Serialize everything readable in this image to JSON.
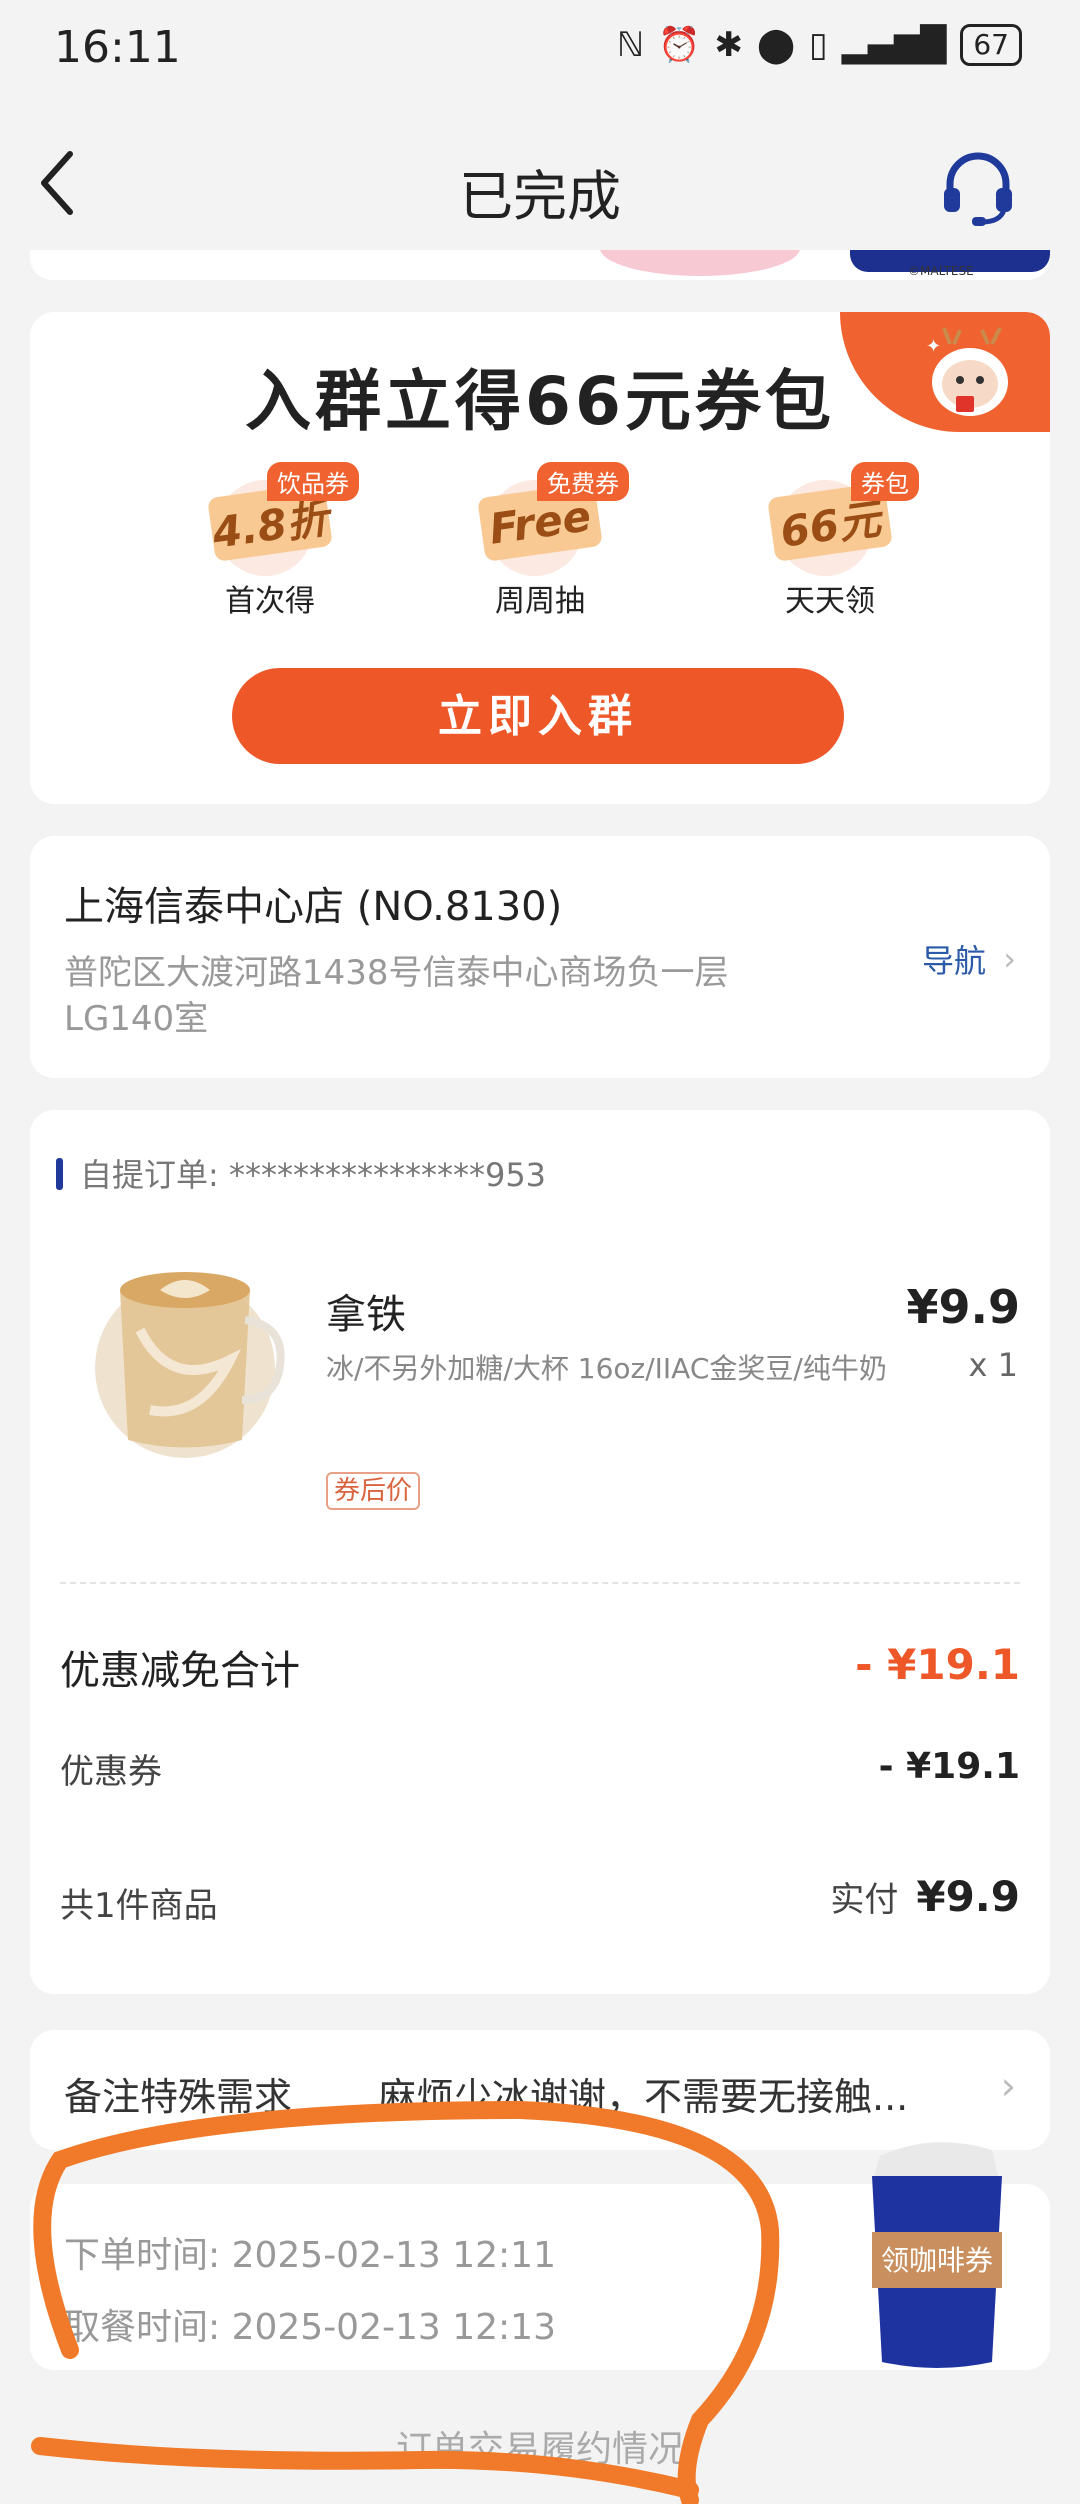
{
  "status_bar": {
    "time": "16:11",
    "battery": "67"
  },
  "nav": {
    "title": "已完成"
  },
  "banner": {
    "brand": "©MALTESE"
  },
  "promo": {
    "title": "入群立得66元券包",
    "perks": [
      {
        "badge": "饮品券",
        "ticket": "4.8折",
        "label": "首次得"
      },
      {
        "badge": "免费券",
        "ticket": "Free",
        "label": "周周抽"
      },
      {
        "badge": "券包",
        "ticket": "66元",
        "label": "天天领"
      }
    ],
    "button": "立即入群"
  },
  "store": {
    "name": "上海信泰中心店 (NO.8130)",
    "address": "普陀区大渡河路1438号信泰中心商场负一层LG140室",
    "nav_label": "导航"
  },
  "order": {
    "header": "自提订单: ****************953",
    "item": {
      "name": "拿铁",
      "spec": "冰/不另外加糖/大杯 16oz/IIAC金奖豆/纯牛奶",
      "tag": "券后价",
      "price": "¥9.9",
      "qty": "x 1"
    },
    "discount_label": "优惠减免合计",
    "discount_value": "- ¥19.1",
    "coupon_label": "优惠券",
    "coupon_value": "- ¥19.1",
    "count_label": "共1件商品",
    "paid_label": "实付",
    "paid_value": "¥9.9"
  },
  "note": {
    "label": "备注特殊需求",
    "value": "麻烦少冰谢谢，不需要无接触..."
  },
  "times": {
    "order_time": "下单时间:  2025-02-13 12:11",
    "pickup_time": "取餐时间:  2025-02-13 12:13"
  },
  "coffee_badge": "领咖啡券",
  "footer_link": "订单交易履约情况",
  "colors": {
    "accent": "#ee5829",
    "brand_blue": "#1f3a9a",
    "annotation": "#f07a2a"
  }
}
